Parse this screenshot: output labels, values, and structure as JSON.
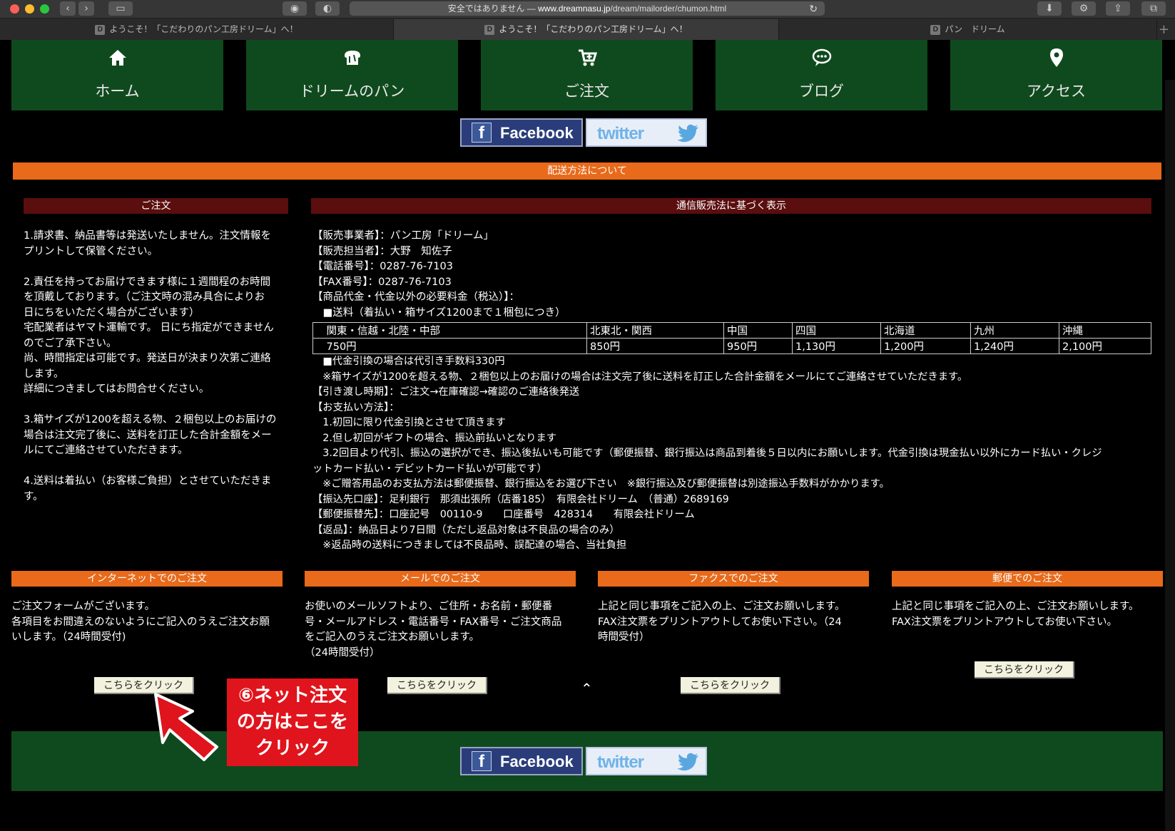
{
  "browser": {
    "url_prefix": "安全ではありません — ",
    "url_domain": "www.dreamnasu.jp",
    "url_path": "/dream/mailorder/chumon.html",
    "tabs": [
      {
        "fav": "D",
        "title": "ようこそ！「こだわりのパン工房ドリーム」へ！"
      },
      {
        "fav": "D",
        "title": "ようこそ！「こだわりのパン工房ドリーム」へ！"
      },
      {
        "fav": "D",
        "title": "パン　ドリーム"
      }
    ]
  },
  "nav": [
    {
      "label": "ホーム",
      "icon": "home-icon"
    },
    {
      "label": "ドリームのパン",
      "icon": "bread-icon"
    },
    {
      "label": "ご注文",
      "icon": "cart-icon"
    },
    {
      "label": "ブログ",
      "icon": "chat-icon"
    },
    {
      "label": "アクセス",
      "icon": "map-pin-icon"
    }
  ],
  "social": {
    "facebook": "Facebook",
    "twitter": "twitter"
  },
  "banner": "配送方法について",
  "order": {
    "header": "ご注文",
    "text": "1.請求書、納品書等は発送いたしません。注文情報を\nプリントして保管ください。\n\n2.責任を持ってお届けできます様に１週間程のお時間\nを頂戴しております。（ご注文時の混み具合によりお\n日にちをいただく場合がございます）\n宅配業者はヤマト運輸です。 日にち指定ができません\nのでご了承下さい。\n尚、時間指定は可能です。発送日が決まり次第ご連絡\nします。\n詳細につきましてはお問合せください。\n\n3.箱サイズが1200を超える物、２梱包以上のお届けの\n場合は注文完了後に、送料を訂正した合計金額をメー\nルにてご連絡させていただきます。\n\n4.送料は着払い（お客様ご負担）とさせていただきま\nす。"
  },
  "legal": {
    "header": "通信販売法に基づく表示",
    "text_top": "【販売事業者】：パン工房「ドリーム」\n【販売担当者】：大野　知佐子\n【電話番号】：0287-76-7103\n【FAX番号】：0287-76-7103\n【商品代金・代金以外の必要料金（税込）】：\n　■送料（着払い・箱サイズ1200まで１梱包につき）",
    "text_bottom": "　■代金引換の場合は代引き手数料330円\n　※箱サイズが1200を超える物、２梱包以上のお届けの場合は注文完了後に送料を訂正した合計金額をメールにてご連絡させていただきます。\n【引き渡し時期】：ご注文→在庫確認→確認のご連絡後発送\n【お支払い方法】：\n　1.初回に限り代金引換とさせて頂きます\n　2.但し初回がギフトの場合、振込前払いとなります\n　3.2回目より代引、振込の選択ができ、振込後払いも可能です（郵便振替、銀行振込は商品到着後５日以内にお願いします。代金引換は現金払い以外にカード払い・クレジ\nットカード払い・デビットカード払いが可能です）\n　※ご贈答用品のお支払方法は郵便振替、銀行振込をお選び下さい　※銀行振込及び郵便振替は別途振込手数料がかかります。\n【振込先口座】：足利銀行　那須出張所（店番185）　有限会社ドリーム　（普通）2689169\n【郵便振替先】：口座記号　00110-9　　口座番号　428314　　有限会社ドリーム\n【返品】：納品日より7日間（ただし返品対象は不良品の場合のみ）\n　※返品時の送料につきましては不良品時、誤配達の場合、当社負担",
    "shipping_table": {
      "regions": [
        "　関東・信越・北陸・中部",
        "北東北・関西",
        "中国",
        "四国",
        "北海道",
        "九州",
        "沖縄"
      ],
      "prices": [
        "　750円",
        "850円",
        "950円",
        "1,130円",
        "1,200円",
        "1,240円",
        "2,100円"
      ]
    }
  },
  "methods": [
    {
      "header": "インターネットでのご注文",
      "text": "ご注文フォームがございます。\n各項目をお間違えのないようにご記入のうえご注文お願\nいします。（24時間受付)",
      "button": "こちらをクリック"
    },
    {
      "header": "メールでのご注文",
      "text": "お使いのメールソフトより、ご住所・お名前・郵便番\n号・メールアドレス・電話番号・FAX番号・ご注文商品\nをご記入のうえご注文お願いします。\n（24時間受付）",
      "button": "こちらをクリック"
    },
    {
      "header": "ファクスでのご注文",
      "text": "上記と同じ事項をご記入の上、ご注文お願いします。\nFAX注文票をプリントアウトしてお使い下さい。（24\n時間受付）",
      "button": "こちらをクリック"
    },
    {
      "header": "郵便でのご注文",
      "text": "上記と同じ事項をご記入の上、ご注文お願いします。\nFAX注文票をプリントアウトしてお使い下さい。",
      "button": "こちらをクリック"
    }
  ],
  "callout": "⑥ネット注文\nの方はここを\nクリック",
  "scroll_top": "⌃"
}
